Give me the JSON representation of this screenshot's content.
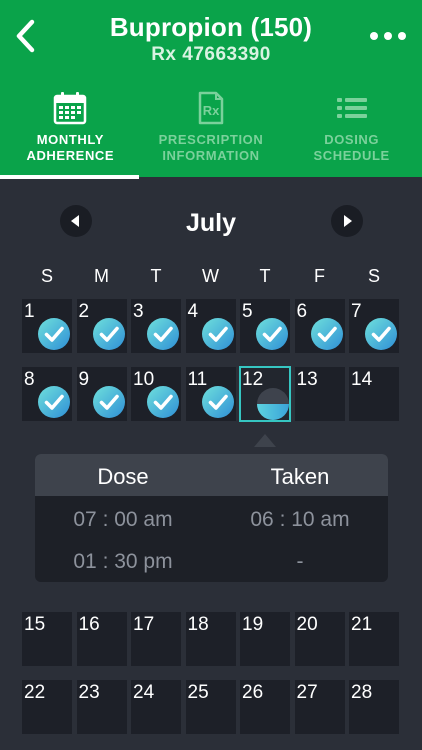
{
  "header": {
    "title": "Bupropion (150)",
    "subtitle": "Rx 47663390",
    "brand_color": "#0aa34a"
  },
  "tabs": [
    {
      "label_line1": "MONTHLY",
      "label_line2": "ADHERENCE",
      "icon": "calendar-icon",
      "active": true
    },
    {
      "label_line1": "PRESCRIPTION",
      "label_line2": "INFORMATION",
      "icon": "prescription-icon",
      "active": false
    },
    {
      "label_line1": "DOSING",
      "label_line2": "SCHEDULE",
      "icon": "list-icon",
      "active": false
    }
  ],
  "calendar": {
    "month": "July",
    "weekdays": [
      "S",
      "M",
      "T",
      "W",
      "T",
      "F",
      "S"
    ],
    "days": [
      {
        "day": "1",
        "status": "taken"
      },
      {
        "day": "2",
        "status": "taken"
      },
      {
        "day": "3",
        "status": "taken"
      },
      {
        "day": "4",
        "status": "taken"
      },
      {
        "day": "5",
        "status": "taken"
      },
      {
        "day": "6",
        "status": "taken"
      },
      {
        "day": "7",
        "status": "taken"
      },
      {
        "day": "8",
        "status": "taken"
      },
      {
        "day": "9",
        "status": "taken"
      },
      {
        "day": "10",
        "status": "taken"
      },
      {
        "day": "11",
        "status": "taken"
      },
      {
        "day": "12",
        "status": "partial"
      },
      {
        "day": "13",
        "status": "none"
      },
      {
        "day": "14",
        "status": "none"
      },
      {
        "day": "15",
        "status": "none"
      },
      {
        "day": "16",
        "status": "none"
      },
      {
        "day": "17",
        "status": "none"
      },
      {
        "day": "18",
        "status": "none"
      },
      {
        "day": "19",
        "status": "none"
      },
      {
        "day": "20",
        "status": "none"
      },
      {
        "day": "21",
        "status": "none"
      },
      {
        "day": "22",
        "status": "none"
      },
      {
        "day": "23",
        "status": "none"
      },
      {
        "day": "24",
        "status": "none"
      },
      {
        "day": "25",
        "status": "none"
      },
      {
        "day": "26",
        "status": "none"
      },
      {
        "day": "27",
        "status": "none"
      },
      {
        "day": "28",
        "status": "none"
      }
    ],
    "selected_day": "12"
  },
  "dose_popup": {
    "dose_header": "Dose",
    "taken_header": "Taken",
    "rows": [
      {
        "dose": "07 : 00 am",
        "taken": "06 : 10 am"
      },
      {
        "dose": "01 : 30 pm",
        "taken": "-"
      }
    ]
  }
}
